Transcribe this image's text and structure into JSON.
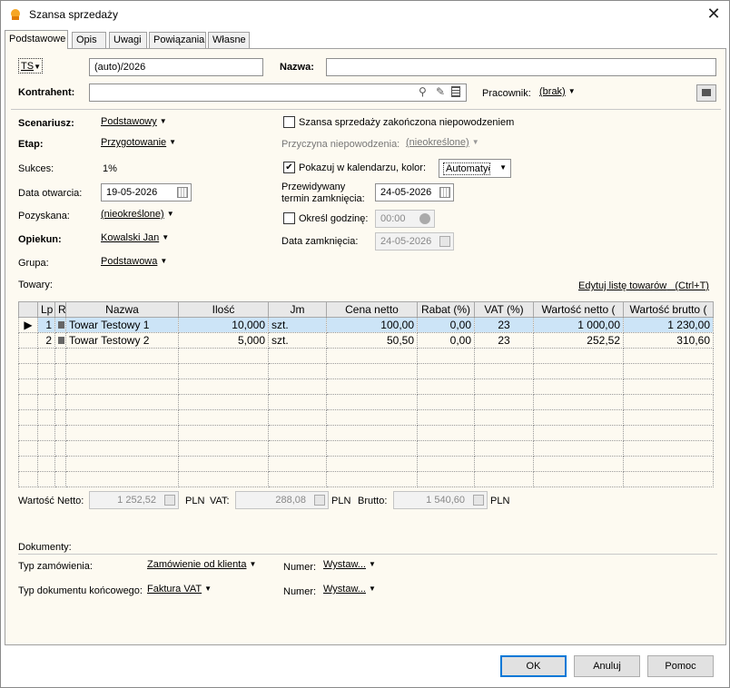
{
  "window": {
    "title": "Szansa sprzedaży",
    "close": "✕"
  },
  "tabs": [
    "Podstawowe",
    "Opis",
    "Uwagi",
    "Powiązania",
    "Własne"
  ],
  "header": {
    "ts_label": "TS",
    "number_value": "(auto)/2026",
    "nazwa_label": "Nazwa:",
    "nazwa_value": "",
    "kontrahent_label": "Kontrahent:",
    "kontrahent_value": "",
    "pracownik_label": "Pracownik:",
    "pracownik_value": "(brak)"
  },
  "left": {
    "scenariusz_label": "Scenariusz:",
    "scenariusz_value": "Podstawowy",
    "etap_label": "Etap:",
    "etap_value": "Przygotowanie",
    "sukces_label": "Sukces:",
    "sukces_value": "1%",
    "data_otwarcia_label": "Data otwarcia:",
    "data_otwarcia_value": "19-05-2026",
    "pozyskana_label": "Pozyskana:",
    "pozyskana_value": "(nieokreślone)",
    "opiekun_label": "Opiekun:",
    "opiekun_value": "Kowalski Jan",
    "grupa_label": "Grupa:",
    "grupa_value": "Podstawowa"
  },
  "right": {
    "zakonczona_label": "Szansa sprzedaży zakończona niepowodzeniem",
    "zakonczona_checked": false,
    "przyczyna_label": "Przyczyna niepowodzenia:",
    "przyczyna_value": "(nieokreślone)",
    "kalendarz_label": "Pokazuj w kalendarzu, kolor:",
    "kalendarz_checked": true,
    "kolor_value": "Automatyczny",
    "przewidywany_label1": "Przewidywany",
    "przewidywany_label2": "termin zamknięcia:",
    "przewidywany_value": "24-05-2026",
    "godzine_label": "Określ godzinę:",
    "godzine_value": "00:00",
    "godzine_checked": false,
    "data_zamkniecia_label": "Data zamknięcia:",
    "data_zamkniecia_value": "24-05-2026"
  },
  "towary": {
    "label": "Towary:",
    "edit_link": "Edytuj listę towarów",
    "edit_shortcut": "(Ctrl+T)",
    "columns": [
      "Lp",
      "R",
      "Nazwa",
      "Ilość",
      "Jm",
      "Cena netto",
      "Rabat (%)",
      "VAT (%)",
      "Wartość netto (",
      "Wartość brutto ("
    ],
    "rows": [
      {
        "lp": "1",
        "nazwa": "Towar Testowy 1",
        "ilosc": "10,000",
        "jm": "szt.",
        "cena": "100,00",
        "rabat": "0,00",
        "vat": "23",
        "netto": "1 000,00",
        "brutto": "1 230,00"
      },
      {
        "lp": "2",
        "nazwa": "Towar Testowy 2",
        "ilosc": "5,000",
        "jm": "szt.",
        "cena": "50,50",
        "rabat": "0,00",
        "vat": "23",
        "netto": "252,52",
        "brutto": "310,60"
      }
    ]
  },
  "totals": {
    "netto_label": "Wartość Netto:",
    "netto_value": "1 252,52",
    "currency": "PLN",
    "vat_label": "VAT:",
    "vat_value": "288,08",
    "brutto_label": "Brutto:",
    "brutto_value": "1 540,60"
  },
  "dokumenty": {
    "label": "Dokumenty:",
    "typ_zam_label": "Typ zamówienia:",
    "typ_zam_value": "Zamówienie od klienta",
    "numer_label": "Numer:",
    "numer1_value": "Wystaw...",
    "typ_konc_label": "Typ dokumentu końcowego:",
    "typ_konc_value": "Faktura VAT",
    "numer2_value": "Wystaw..."
  },
  "buttons": {
    "ok": "OK",
    "cancel": "Anuluj",
    "help": "Pomoc"
  }
}
